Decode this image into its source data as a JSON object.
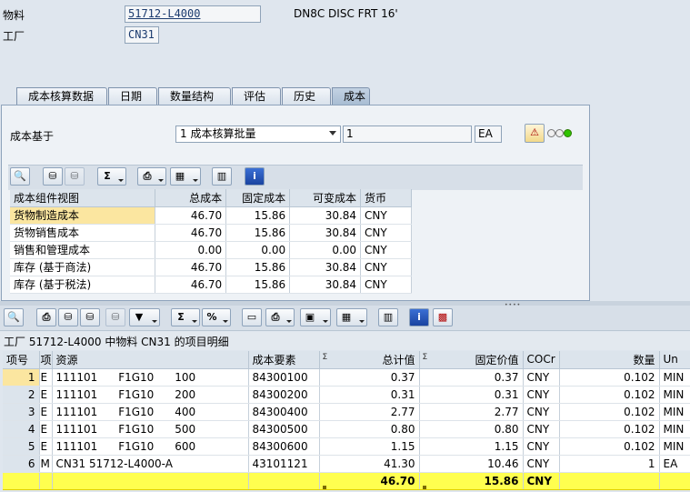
{
  "header": {
    "material_label": "物料",
    "material_value": "51712-L4000",
    "material_desc": "DN8C DISC FRT 16'",
    "plant_label": "工厂",
    "plant_value": "CN31"
  },
  "tabs": [
    {
      "label": "成本核算数据"
    },
    {
      "label": "日期"
    },
    {
      "label": "数量结构"
    },
    {
      "label": "评估"
    },
    {
      "label": "历史"
    },
    {
      "label": "成本"
    }
  ],
  "costing": {
    "basis_label": "成本基于",
    "basis_select": "1 成本核算批量",
    "quantity": "1",
    "unit": "EA"
  },
  "summary_table": {
    "columns": [
      "成本组件视图",
      "总成本",
      "固定成本",
      "可变成本",
      "货币"
    ],
    "rows": [
      {
        "view": "货物制造成本",
        "total": "46.70",
        "fixed": "15.86",
        "variable": "30.84",
        "currency": "CNY"
      },
      {
        "view": "货物销售成本",
        "total": "46.70",
        "fixed": "15.86",
        "variable": "30.84",
        "currency": "CNY"
      },
      {
        "view": "销售和管理成本",
        "total": "0.00",
        "fixed": "0.00",
        "variable": "0.00",
        "currency": "CNY"
      },
      {
        "view": "库存 (基于商法)",
        "total": "46.70",
        "fixed": "15.86",
        "variable": "30.84",
        "currency": "CNY"
      },
      {
        "view": "库存 (基于税法)",
        "total": "46.70",
        "fixed": "15.86",
        "variable": "30.84",
        "currency": "CNY"
      }
    ]
  },
  "detail": {
    "title": "工厂 51712-L4000 中物料 CN31 的项目明细",
    "columns": {
      "item": "项号",
      "type": "项",
      "resource": "资源",
      "cost_element": "成本要素",
      "total_value": "总计值",
      "fixed_value": "固定价值",
      "cocr": "COCr",
      "quantity": "数量",
      "unit": "Un"
    },
    "rows": [
      {
        "item": "1",
        "type": "E",
        "resource": "111101      F1G10      100",
        "cost_element": "84300100",
        "total": "0.37",
        "fixed": "0.37",
        "cocr": "CNY",
        "qty": "0.102",
        "unit": "MIN"
      },
      {
        "item": "2",
        "type": "E",
        "resource": "111101      F1G10      200",
        "cost_element": "84300200",
        "total": "0.31",
        "fixed": "0.31",
        "cocr": "CNY",
        "qty": "0.102",
        "unit": "MIN"
      },
      {
        "item": "3",
        "type": "E",
        "resource": "111101      F1G10      400",
        "cost_element": "84300400",
        "total": "2.77",
        "fixed": "2.77",
        "cocr": "CNY",
        "qty": "0.102",
        "unit": "MIN"
      },
      {
        "item": "4",
        "type": "E",
        "resource": "111101      F1G10      500",
        "cost_element": "84300500",
        "total": "0.80",
        "fixed": "0.80",
        "cocr": "CNY",
        "qty": "0.102",
        "unit": "MIN"
      },
      {
        "item": "5",
        "type": "E",
        "resource": "111101      F1G10      600",
        "cost_element": "84300600",
        "total": "1.15",
        "fixed": "1.15",
        "cocr": "CNY",
        "qty": "0.102",
        "unit": "MIN"
      },
      {
        "item": "6",
        "type": "M",
        "resource": "CN31 51712-L4000-A",
        "cost_element": "43101121",
        "total": "41.30",
        "fixed": "10.46",
        "cocr": "CNY",
        "qty": "1",
        "unit": "EA"
      }
    ],
    "totals": {
      "total": "46.70",
      "fixed": "15.86",
      "cocr": "CNY"
    }
  },
  "colors": {
    "selected_row": "#fbe6a0",
    "total_row": "#ffff4f",
    "header_bg": "#dce4ec"
  }
}
